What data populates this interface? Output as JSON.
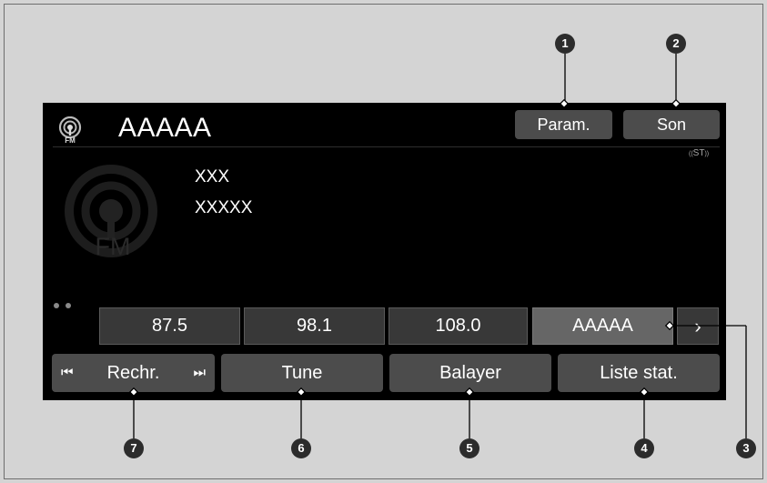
{
  "header": {
    "station_name": "AAAAA",
    "param_label": "Param.",
    "son_label": "Son",
    "stereo_label": "ST"
  },
  "band_icon_label": "FM",
  "fm_logo_label": "FM",
  "info": {
    "line1": "XXX",
    "line2": "XXXXX"
  },
  "presets": [
    "87.5",
    "98.1",
    "108.0",
    "AAAAA"
  ],
  "controls": {
    "seek_label": "Rechr.",
    "tune_label": "Tune",
    "scan_label": "Balayer",
    "list_label": "Liste stat."
  },
  "callouts": [
    "1",
    "2",
    "3",
    "4",
    "5",
    "6",
    "7"
  ]
}
